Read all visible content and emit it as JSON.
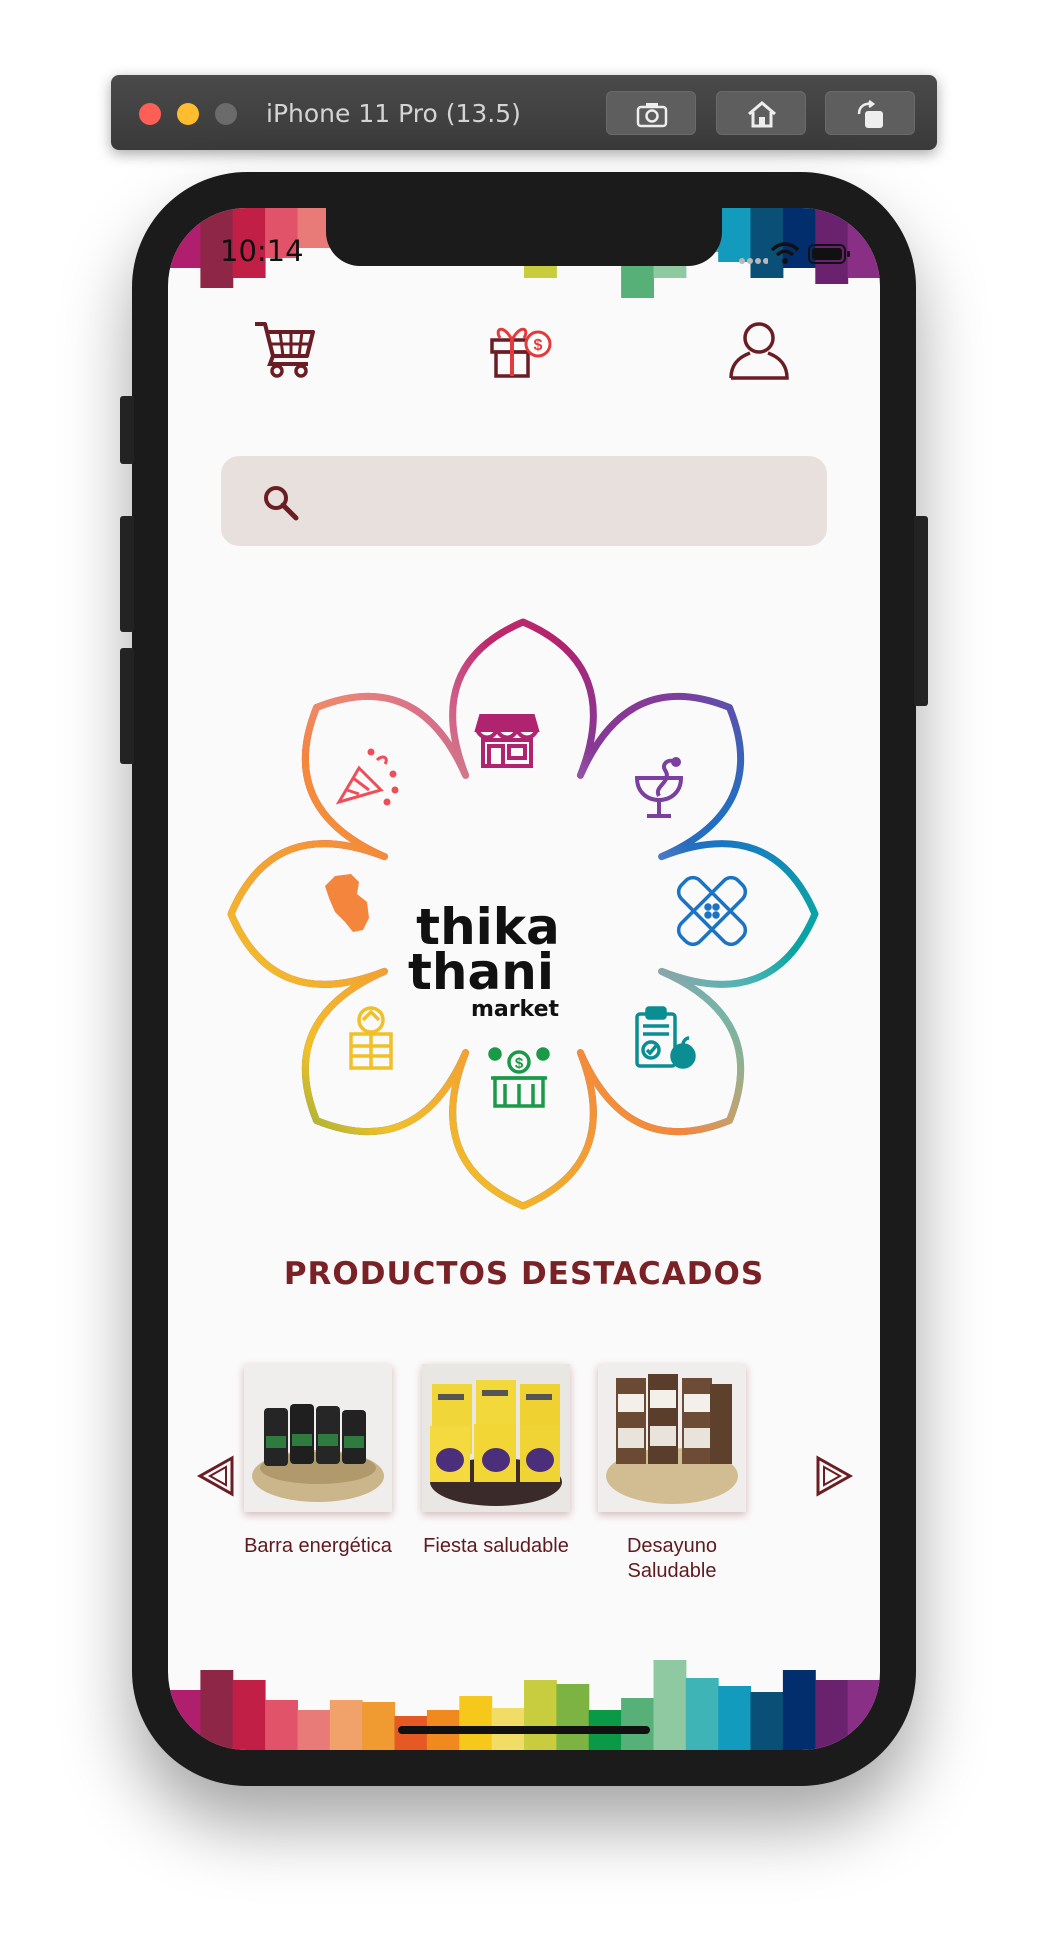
{
  "simulator": {
    "title": "iPhone 11 Pro (13.5)",
    "buttons": [
      "camera-icon",
      "home-icon",
      "rotate-icon"
    ]
  },
  "status_bar": {
    "time": "10:14"
  },
  "tabs": [
    {
      "name": "cart-icon"
    },
    {
      "name": "gift-icon"
    },
    {
      "name": "user-icon"
    }
  ],
  "search": {
    "placeholder": "",
    "value": ""
  },
  "logo": {
    "line1": "thika",
    "line2": "thani",
    "line3": "market"
  },
  "categories": [
    {
      "icon": "store-icon",
      "color": "#b0236e"
    },
    {
      "icon": "pharmacy-icon",
      "color": "#7b3fa0"
    },
    {
      "icon": "bandage-icon",
      "color": "#1b73c4"
    },
    {
      "icon": "nutrition-icon",
      "color": "#0aa3a7"
    },
    {
      "icon": "bank-icon",
      "color": "#1a9a49"
    },
    {
      "icon": "tourism-icon",
      "color": "#f1c028"
    },
    {
      "icon": "peru-map-icon",
      "color": "#f4853d"
    },
    {
      "icon": "party-icon",
      "color": "#ee4d5a"
    }
  ],
  "featured": {
    "title": "PRODUCTOS DESTACADOS",
    "products": [
      {
        "name": "Barra energética"
      },
      {
        "name": "Fiesta saludable"
      },
      {
        "name": "Desayuno Saludable"
      }
    ]
  },
  "stripe_colors": [
    "#b01e6e",
    "#8e2648",
    "#c21f47",
    "#e05369",
    "#e87b78",
    "#f1a26a",
    "#ef9b32",
    "#e55a24",
    "#f08a1e",
    "#f6c81b",
    "#f1dd65",
    "#c8cc3f",
    "#7cb342",
    "#0a9a47",
    "#58b079",
    "#8fc9a2",
    "#3fb4b6",
    "#139bbd",
    "#0a4f75",
    "#022e6e",
    "#6a226f",
    "#8a2f86"
  ]
}
